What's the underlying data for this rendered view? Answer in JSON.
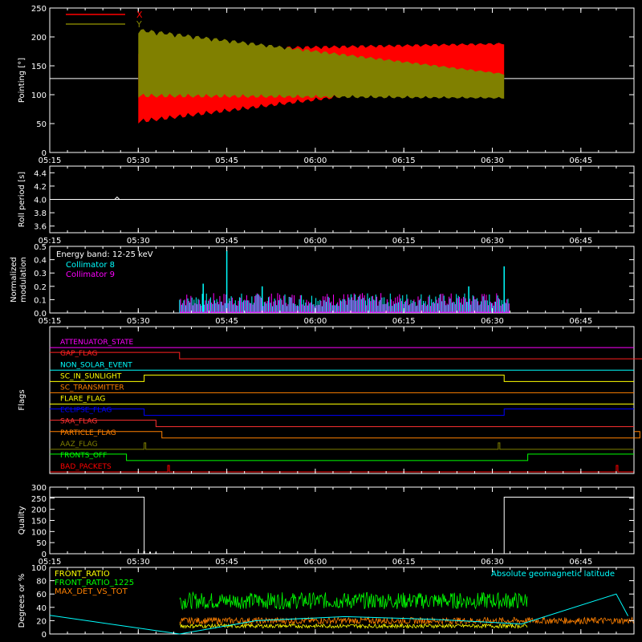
{
  "chart_data": [
    {
      "type": "line",
      "ylabel": "Pointing [°]",
      "ylim": [
        0,
        250
      ],
      "yticks": [
        0,
        50,
        100,
        150,
        200,
        250
      ],
      "xticks": [
        "05:15",
        "05:30",
        "05:45",
        "06:00",
        "06:15",
        "06:30",
        "06:45"
      ],
      "legend": [
        "X",
        "Y"
      ],
      "colors": {
        "X": "#ff0000",
        "Y": "#808000",
        "baseline": "#ffffff"
      },
      "baseline_value": 128,
      "active_range": [
        "05:30",
        "06:32"
      ],
      "series": [
        {
          "name": "X",
          "center_start": 115,
          "center_end": 160,
          "amplitude_start": 65,
          "amplitude_end": 30
        },
        {
          "name": "Y",
          "center_start": 155,
          "center_end": 115,
          "amplitude_start": 60,
          "amplitude_end": 22
        }
      ]
    },
    {
      "type": "line",
      "ylabel": "Roll period [s]",
      "ylim": [
        3.5,
        4.5
      ],
      "yticks": [
        "3.6",
        "3.8",
        "4.0",
        "4.2",
        "4.4"
      ],
      "xticks": [
        "05:15",
        "05:30",
        "05:45",
        "06:00",
        "06:15",
        "06:30",
        "06:45"
      ],
      "value": 4.0
    },
    {
      "type": "bar",
      "ylabel": [
        "Normalized",
        "modulation"
      ],
      "ylim": [
        0,
        0.5
      ],
      "yticks": [
        "0.0",
        "0.1",
        "0.2",
        "0.3",
        "0.4",
        "0.5"
      ],
      "xticks": [
        "05:15",
        "05:30",
        "05:45",
        "06:00",
        "06:15",
        "06:30",
        "06:45"
      ],
      "annotation": "Energy band: 12-25 keV",
      "legend": [
        "Collimator 8",
        "Collimator 9"
      ],
      "colors": {
        "Collimator 8": "#00ffff",
        "Collimator 9": "#ff00ff"
      },
      "active_range": [
        "05:37",
        "06:33"
      ],
      "typical_level": 0.1,
      "spikes": [
        {
          "time": "05:45",
          "value": 0.47
        },
        {
          "time": "05:41",
          "value": 0.22
        },
        {
          "time": "06:32",
          "value": 0.35
        },
        {
          "time": "05:51",
          "value": 0.2
        },
        {
          "time": "06:26",
          "value": 0.2
        }
      ]
    },
    {
      "type": "line",
      "ylabel": "Flags",
      "flags": [
        {
          "name": "ATTENUATOR_STATE",
          "color": "#ff00ff",
          "transitions": []
        },
        {
          "name": "GAP_FLAG",
          "color": "#ff2020",
          "transitions": [
            [
              "05:37",
              "low"
            ],
            [
              "06:57",
              "spike"
            ]
          ]
        },
        {
          "name": "NON_SOLAR_EVENT",
          "color": "#00ffff",
          "transitions": []
        },
        {
          "name": "SC_IN_SUNLIGHT",
          "color": "#ffff00",
          "transitions": [
            [
              "05:31",
              "high"
            ],
            [
              "06:32",
              "low"
            ]
          ]
        },
        {
          "name": "SC_TRANSMITTER",
          "color": "#ff8000",
          "transitions": []
        },
        {
          "name": "FLARE_FLAG",
          "color": "#ffff00",
          "transitions": []
        },
        {
          "name": "ECLIPSE_FLAG",
          "color": "#0000ff",
          "transitions": [
            [
              "05:31",
              "low"
            ],
            [
              "06:32",
              "high"
            ]
          ]
        },
        {
          "name": "SAA_FLAG",
          "color": "#ff3030",
          "transitions": [
            [
              "05:33",
              "low"
            ]
          ]
        },
        {
          "name": "PARTICLE_FLAG",
          "color": "#ff8000",
          "transitions": [
            [
              "05:34",
              "low"
            ],
            [
              "06:55",
              "high"
            ]
          ]
        },
        {
          "name": "AAZ_FLAG",
          "color": "#808000",
          "transitions": [
            [
              "05:31",
              "pulse"
            ],
            [
              "06:31",
              "pulse"
            ]
          ]
        },
        {
          "name": "FRONTS_OFF",
          "color": "#00ff00",
          "transitions": [
            [
              "05:28",
              "low"
            ],
            [
              "06:36",
              "high"
            ]
          ]
        },
        {
          "name": "BAD_PACKETS",
          "color": "#ff0000",
          "transitions": [
            [
              "05:35",
              "spike"
            ],
            [
              "06:51",
              "spike"
            ]
          ]
        }
      ],
      "xticks": []
    },
    {
      "type": "line",
      "ylabel": "Quality",
      "ylim": [
        0,
        300
      ],
      "yticks": [
        0,
        50,
        100,
        150,
        200,
        250,
        300
      ],
      "xticks": [
        "05:15",
        "05:30",
        "05:45",
        "06:00",
        "06:15",
        "06:30",
        "06:45"
      ],
      "segments": [
        {
          "from": "05:15",
          "to": "05:31",
          "value": 255
        },
        {
          "from": "05:31",
          "to": "06:32",
          "value": 0
        },
        {
          "from": "06:32",
          "to": "06:54",
          "value": 255
        }
      ]
    },
    {
      "type": "line",
      "ylabel": "Degrees or %",
      "ylim": [
        0,
        100
      ],
      "yticks": [
        0,
        20,
        40,
        60,
        80,
        100
      ],
      "xticks": [],
      "legend": [
        "FRONT_RATIO",
        "FRONT_RATIO_1225",
        "MAX_DET_VS_TOT"
      ],
      "right_label": "Absolute geomagnetic latitude",
      "colors": {
        "FRONT_RATIO": "#ffff00",
        "FRONT_RATIO_1225": "#00ff00",
        "MAX_DET_VS_TOT": "#ff8000",
        "Absolute geomagnetic latitude": "#00ffff"
      },
      "series": [
        {
          "name": "FRONT_RATIO_1225",
          "active_range": [
            "05:37",
            "06:36"
          ],
          "typical": 50
        },
        {
          "name": "MAX_DET_VS_TOT",
          "active_range": [
            "05:37",
            "06:54"
          ],
          "typical": 20
        },
        {
          "name": "FRONT_RATIO",
          "active_range": [
            "05:37",
            "06:36"
          ],
          "typical": 12
        },
        {
          "name": "Absolute geomagnetic latitude",
          "points": [
            [
              "05:15",
              28
            ],
            [
              "05:37",
              0
            ],
            [
              "05:50",
              20
            ],
            [
              "06:05",
              26
            ],
            [
              "06:20",
              22
            ],
            [
              "06:35",
              15
            ],
            [
              "06:51",
              60
            ],
            [
              "06:53",
              27
            ]
          ]
        }
      ]
    }
  ]
}
